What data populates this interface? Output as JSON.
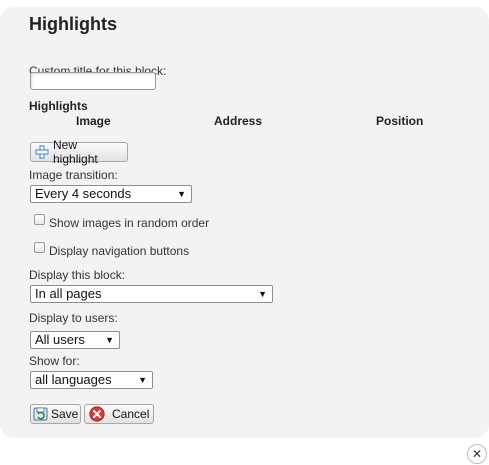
{
  "dialog": {
    "title": "Highlights",
    "custom_title_label": "Custom title for this block:",
    "custom_title_value": "",
    "section_title": "Highlights",
    "columns": [
      "Image",
      "Address",
      "Position"
    ],
    "new_highlight_label": "New highlight",
    "image_transition_label": "Image transition:",
    "image_transition_value": "Every 4 seconds",
    "random_order_label": "Show images in random order",
    "random_order_checked": false,
    "nav_buttons_label": "Display navigation buttons",
    "nav_buttons_checked": false,
    "display_block_label": "Display this block:",
    "display_block_value": "In all pages",
    "display_users_label": "Display to users:",
    "display_users_value": "All users",
    "show_for_label": "Show for:",
    "show_for_value": "all languages",
    "save_label": "Save",
    "cancel_label": "Cancel"
  },
  "icons": {
    "add": "plus-icon",
    "save": "save-icon",
    "cancel": "cancel-icon",
    "close": "close-icon"
  },
  "colors": {
    "panel_bg": "#f3f3f3",
    "cancel_red": "#d63a3a",
    "plus_blue": "#3d7fd1"
  }
}
